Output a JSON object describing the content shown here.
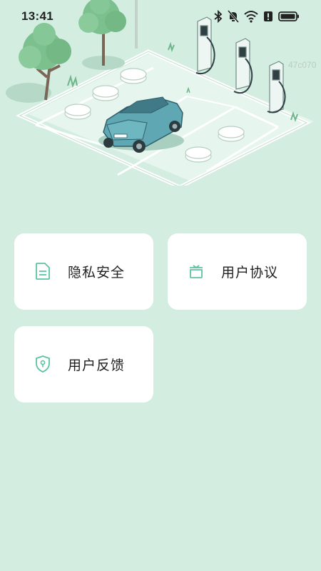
{
  "status_bar": {
    "time": "13:41",
    "icons": [
      "bluetooth-icon",
      "bell-off-icon",
      "wifi-icon",
      "alert-icon",
      "battery-icon"
    ]
  },
  "hero": {
    "watermark": "47c070"
  },
  "menu": {
    "items": [
      {
        "id": "privacy",
        "label": "隐私安全",
        "icon": "document-icon"
      },
      {
        "id": "agreement",
        "label": "用户协议",
        "icon": "gift-box-icon"
      },
      {
        "id": "feedback",
        "label": "用户反馈",
        "icon": "shield-icon"
      }
    ]
  },
  "colors": {
    "background": "#d3eee0",
    "card": "#ffffff",
    "icon_accent": "#5cc3a0",
    "text": "#1f1f1f"
  }
}
